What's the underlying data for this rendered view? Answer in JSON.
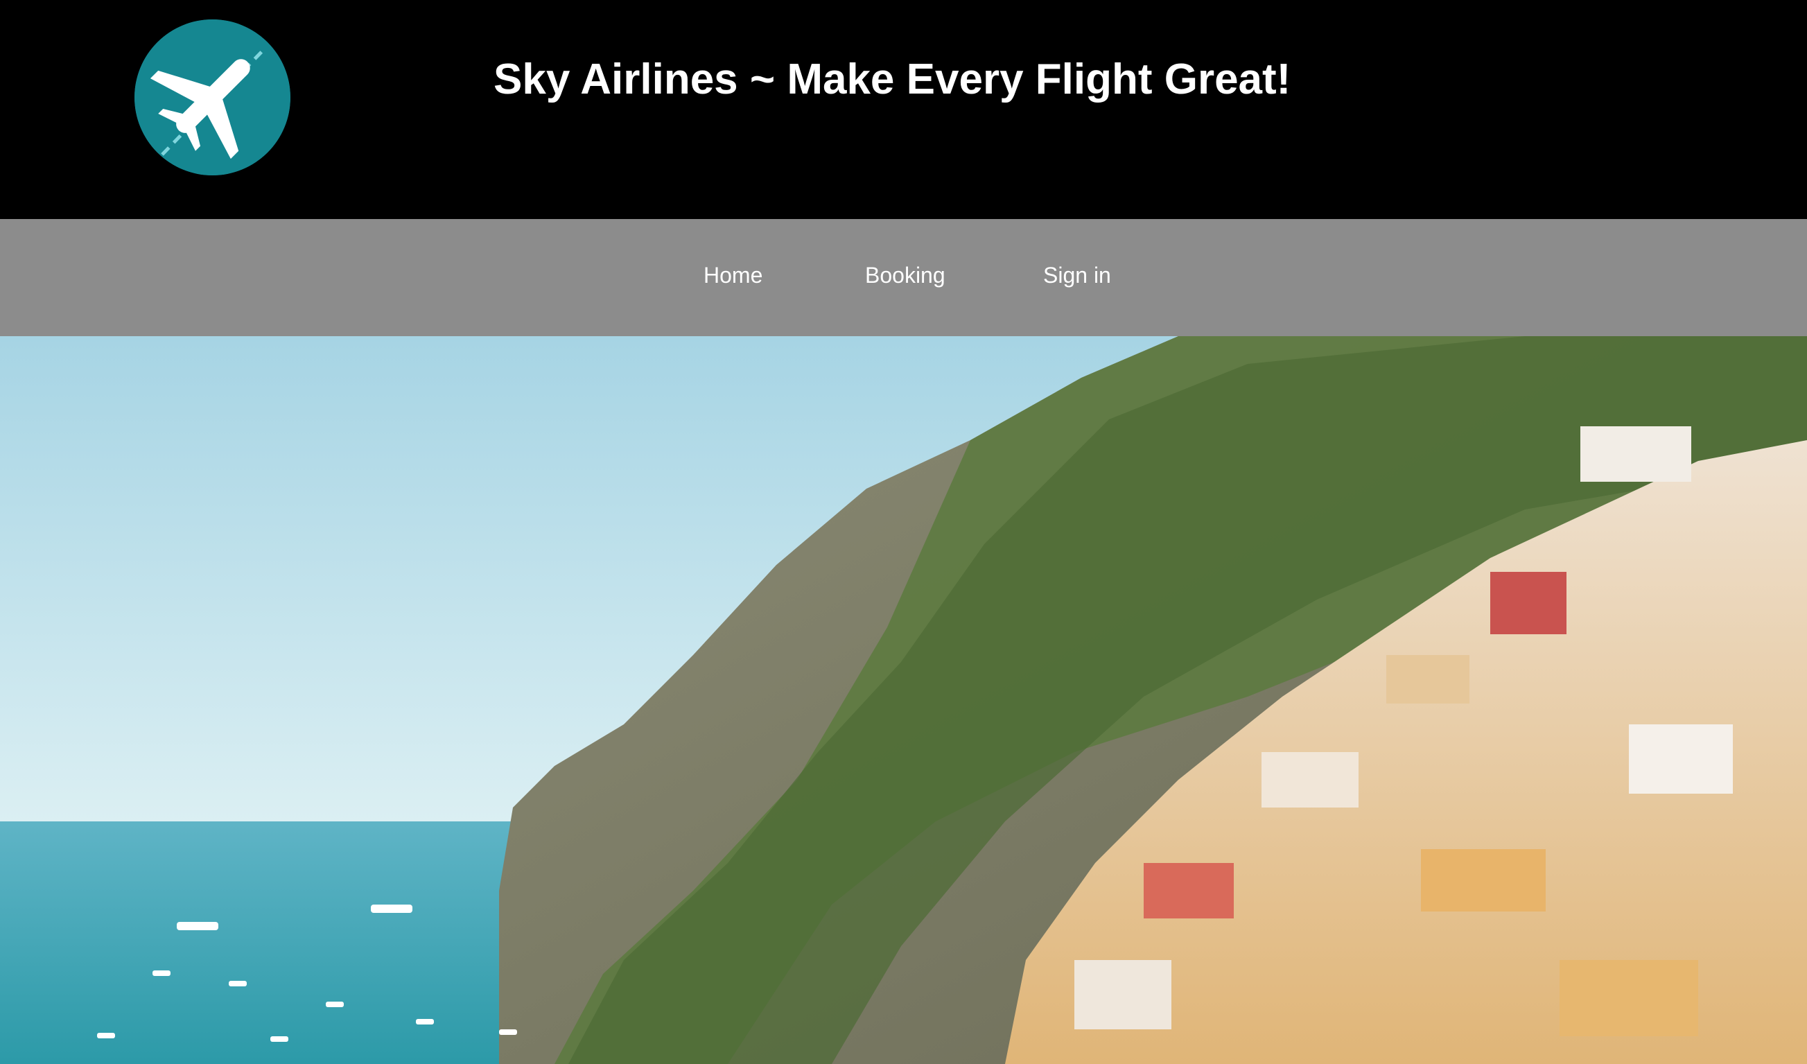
{
  "header": {
    "logo_icon": "airplane-icon",
    "logo_color": "#158791",
    "title": "Sky Airlines ~ Make Every Flight Great!"
  },
  "nav": {
    "items": [
      {
        "label": "Home"
      },
      {
        "label": "Booking"
      },
      {
        "label": "Sign in"
      }
    ]
  },
  "hero": {
    "image": "coastal-cliff-town-photo"
  }
}
